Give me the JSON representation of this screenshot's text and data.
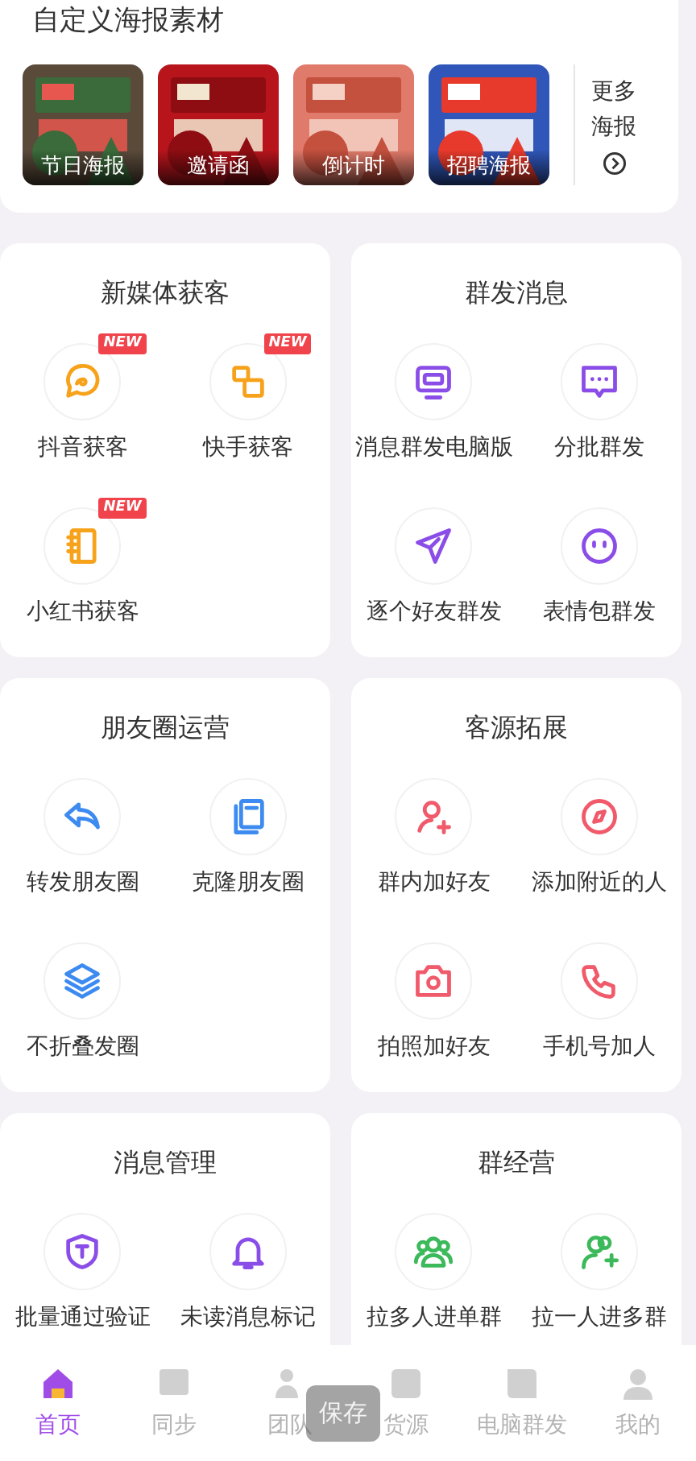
{
  "poster_section": {
    "title": "自定义海报素材",
    "posters": [
      {
        "label": "节日海报"
      },
      {
        "label": "邀请函"
      },
      {
        "label": "倒计时"
      },
      {
        "label": "招聘海报"
      }
    ],
    "more": {
      "label": "更多海报"
    }
  },
  "sections": [
    {
      "title": "新媒体获客",
      "items": [
        {
          "label": "抖音获客",
          "badge": "NEW"
        },
        {
          "label": "快手获客",
          "badge": "NEW"
        },
        {
          "label": "小红书获客",
          "badge": "NEW"
        }
      ]
    },
    {
      "title": "群发消息",
      "items": [
        {
          "label": "消息群发电脑版"
        },
        {
          "label": "分批群发"
        },
        {
          "label": "逐个好友群发"
        },
        {
          "label": "表情包群发"
        }
      ]
    },
    {
      "title": "朋友圈运营",
      "items": [
        {
          "label": "转发朋友圈"
        },
        {
          "label": "克隆朋友圈"
        },
        {
          "label": "不折叠发圈"
        }
      ]
    },
    {
      "title": "客源拓展",
      "items": [
        {
          "label": "群内加好友"
        },
        {
          "label": "添加附近的人"
        },
        {
          "label": "拍照加好友"
        },
        {
          "label": "手机号加人"
        }
      ]
    },
    {
      "title": "消息管理",
      "items": [
        {
          "label": "批量通过验证"
        },
        {
          "label": "未读消息标记"
        }
      ]
    },
    {
      "title": "群经营",
      "items": [
        {
          "label": "拉多人进单群"
        },
        {
          "label": "拉一人进多群"
        }
      ]
    }
  ],
  "tab_bar": {
    "tabs": [
      {
        "label": "首页",
        "selected": true
      },
      {
        "label": "同步",
        "selected": false
      },
      {
        "label": "团队",
        "selected": false
      },
      {
        "label": "货源",
        "selected": false
      },
      {
        "label": "电脑群发",
        "selected": false
      },
      {
        "label": "我的",
        "selected": false
      }
    ]
  },
  "toast": {
    "text": "保存"
  }
}
